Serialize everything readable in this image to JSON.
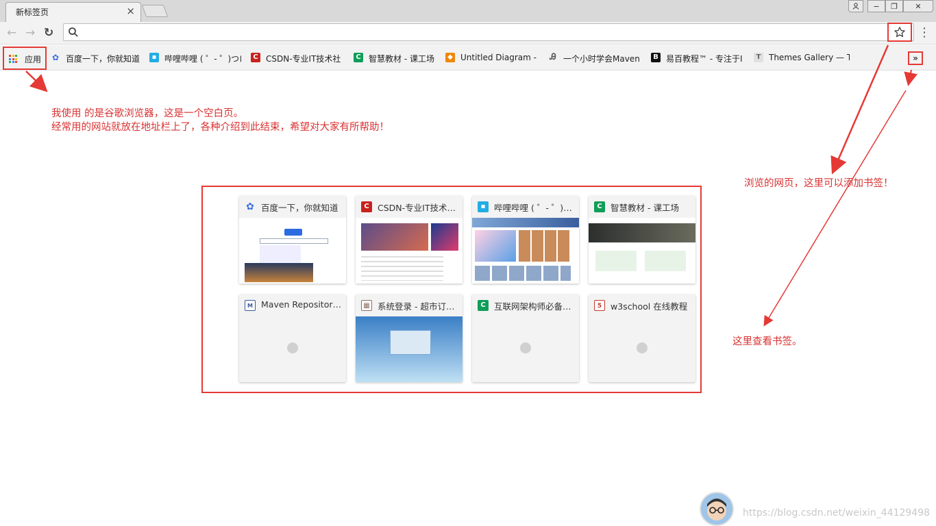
{
  "tab": {
    "title": "新标签页",
    "close": "×"
  },
  "window_controls": {
    "user": "☻",
    "minimize": "−",
    "restore": "❐",
    "close": "✕"
  },
  "toolbar": {
    "back": "←",
    "forward": "→",
    "reload": "↻",
    "address_value": "",
    "menu": "⋮"
  },
  "bookmarks_bar": {
    "apps_label": "应用",
    "items": [
      {
        "label": "百度一下，你就知道",
        "icon": "baidu-paw-icon",
        "color": "#3a6fe0",
        "glyph": "🐾"
      },
      {
        "label": "哔哩哔哩 ( ゜- ゜)つロ",
        "icon": "bilibili-tv-icon",
        "color": "#23ade5",
        "glyph": "▣"
      },
      {
        "label": "CSDN-专业IT技术社",
        "icon": "csdn-c-icon",
        "color": "#c9221e",
        "glyph": "C"
      },
      {
        "label": "智慧教材 - 课工场",
        "icon": "kgc-c-icon",
        "color": "#0f9d58",
        "glyph": "C"
      },
      {
        "label": "Untitled Diagram - ",
        "icon": "drawio-icon",
        "color": "#f08705",
        "glyph": "◆"
      },
      {
        "label": "一个小时学会Maven",
        "icon": "maven-feather-icon",
        "color": "#555555",
        "glyph": "Ꭿ"
      },
      {
        "label": "易百教程™ - 专注于I",
        "icon": "yiibai-b-icon",
        "color": "#111111",
        "glyph": "B"
      },
      {
        "label": "Themes Gallery — T",
        "icon": "themes-t-icon",
        "color": "#9e9e9e",
        "glyph": "T"
      }
    ],
    "overflow": "»"
  },
  "annotations": {
    "intro_line1": "我使用  的是谷歌浏览器，这是一个空白页。",
    "intro_line2": "经常用的网站就放在地址栏上了，各种介绍到此结束，希望对大家有所帮助！",
    "bookmark_hint": "浏览的网页，这里可以添加书签！",
    "view_hint": "这里查看书签。"
  },
  "tiles": [
    {
      "title": "百度一下，你就知道",
      "icon": "baidu-paw-icon",
      "color": "#3a6fe0",
      "glyph": "🐾"
    },
    {
      "title": "CSDN-专业IT技术社区",
      "icon": "csdn-c-icon",
      "color": "#c9221e",
      "glyph": "C"
    },
    {
      "title": "哔哩哔哩 ( ゜- ゜)つロ 干杯",
      "icon": "bilibili-tv-icon",
      "color": "#23ade5",
      "glyph": "▣"
    },
    {
      "title": "智慧教材 - 课工场",
      "icon": "kgc-c-icon",
      "color": "#0f9d58",
      "glyph": "C"
    },
    {
      "title": "Maven Repository: Search",
      "icon": "mvn-logo-icon",
      "color": "#3c5a99",
      "glyph": "M"
    },
    {
      "title": "系统登录 - 超市订单管理系统",
      "icon": "image-icon",
      "color": "#8d6e63",
      "glyph": "▦"
    },
    {
      "title": "互联网架构师必备技能",
      "icon": "kgc-c-icon",
      "color": "#0f9d58",
      "glyph": "C"
    },
    {
      "title": "w3school 在线教程",
      "icon": "w3school-icon",
      "color": "#c0392b",
      "glyph": "5"
    }
  ],
  "watermark": "https://blog.csdn.net/weixin_44129498"
}
